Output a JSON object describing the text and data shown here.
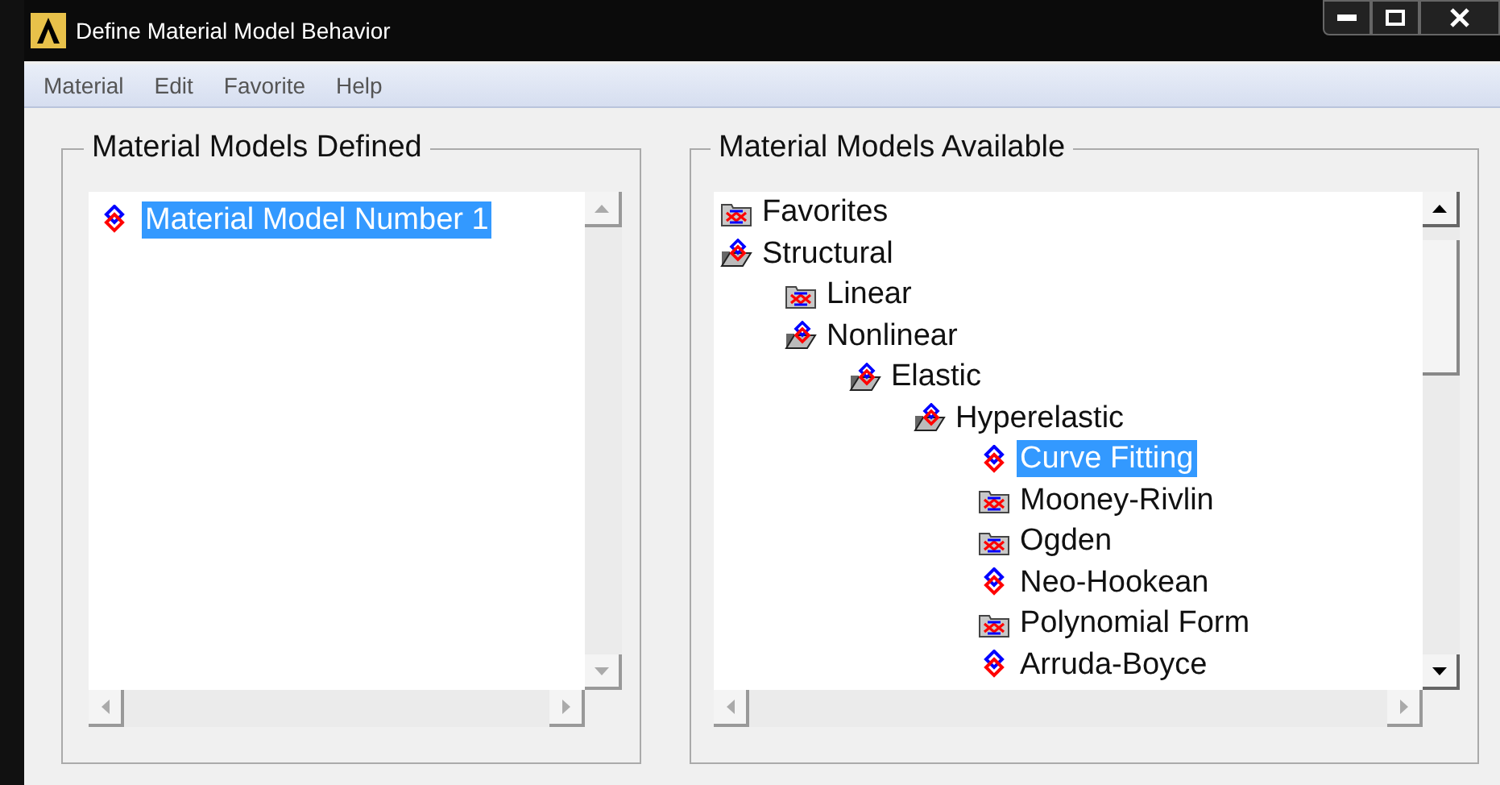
{
  "window": {
    "title": "Define Material Model Behavior"
  },
  "menu": [
    "Material",
    "Edit",
    "Favorite",
    "Help"
  ],
  "defined": {
    "title": "Material Models Defined",
    "items": [
      {
        "label": "Material Model Number 1",
        "selected": true
      }
    ]
  },
  "available": {
    "title": "Material Models Available",
    "tree": [
      {
        "label": "Favorites",
        "kind": "folder",
        "expanded": false,
        "selected": false
      },
      {
        "label": "Structural",
        "kind": "folder",
        "expanded": true,
        "selected": false,
        "children": [
          {
            "label": "Linear",
            "kind": "folder",
            "expanded": false,
            "selected": false
          },
          {
            "label": "Nonlinear",
            "kind": "folder",
            "expanded": true,
            "selected": false,
            "children": [
              {
                "label": "Elastic",
                "kind": "folder",
                "expanded": true,
                "selected": false,
                "children": [
                  {
                    "label": "Hyperelastic",
                    "kind": "folder",
                    "expanded": true,
                    "selected": false,
                    "children": [
                      {
                        "label": "Curve Fitting",
                        "kind": "model",
                        "selected": true
                      },
                      {
                        "label": "Mooney-Rivlin",
                        "kind": "folder",
                        "expanded": false,
                        "selected": false
                      },
                      {
                        "label": "Ogden",
                        "kind": "folder",
                        "expanded": false,
                        "selected": false
                      },
                      {
                        "label": "Neo-Hookean",
                        "kind": "model",
                        "selected": false
                      },
                      {
                        "label": "Polynomial Form",
                        "kind": "folder",
                        "expanded": false,
                        "selected": false
                      },
                      {
                        "label": "Arruda-Boyce",
                        "kind": "model",
                        "selected": false
                      }
                    ]
                  }
                ]
              }
            ]
          }
        ]
      }
    ]
  }
}
